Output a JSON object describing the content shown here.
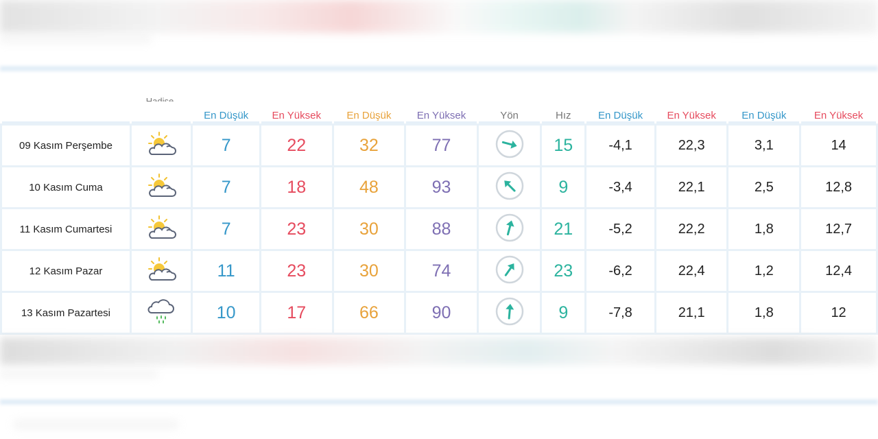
{
  "header": {
    "hadise": "Hadise",
    "columns": [
      "En Düşük",
      "En Yüksek",
      "En Düşük",
      "En Yüksek",
      "Yön",
      "Hız",
      "En Düşük",
      "En Yüksek",
      "En Düşük",
      "En Yüksek"
    ]
  },
  "rows": [
    {
      "day": "09 Kasım Perşembe",
      "icon": "partly-cloudy-sun-icon",
      "c1": "7",
      "c2": "22",
      "c3": "32",
      "c4": "77",
      "wind_dir": "arrow-right-icon",
      "wind_speed": "15",
      "c7": "-4,1",
      "c8": "22,3",
      "c9": "3,1",
      "c10": "14"
    },
    {
      "day": "10 Kasım Cuma",
      "icon": "partly-cloudy-sun-icon",
      "c1": "7",
      "c2": "18",
      "c3": "48",
      "c4": "93",
      "wind_dir": "arrow-down-left-icon",
      "wind_speed": "9",
      "c7": "-3,4",
      "c8": "22,1",
      "c9": "2,5",
      "c10": "12,8"
    },
    {
      "day": "11 Kasım Cumartesi",
      "icon": "partly-cloudy-sun-icon",
      "c1": "7",
      "c2": "23",
      "c3": "30",
      "c4": "88",
      "wind_dir": "arrow-up-slight-right-icon",
      "wind_speed": "21",
      "c7": "-5,2",
      "c8": "22,2",
      "c9": "1,8",
      "c10": "12,7"
    },
    {
      "day": "12 Kasım Pazar",
      "icon": "partly-cloudy-sun-icon",
      "c1": "11",
      "c2": "23",
      "c3": "30",
      "c4": "74",
      "wind_dir": "arrow-up-right-icon",
      "wind_speed": "23",
      "c7": "-6,2",
      "c8": "22,4",
      "c9": "1,2",
      "c10": "12,4"
    },
    {
      "day": "13 Kasım Pazartesi",
      "icon": "rain-cloud-icon",
      "c1": "10",
      "c2": "17",
      "c3": "66",
      "c4": "90",
      "wind_dir": "arrow-up-icon",
      "wind_speed": "9",
      "c7": "-7,8",
      "c8": "21,1",
      "c9": "1,8",
      "c10": "12"
    }
  ],
  "colors": {
    "blue": "#3597c9",
    "red": "#e64b5e",
    "orange": "#e8a23a",
    "purple": "#7e6fb3",
    "teal": "#2bb39e",
    "grid": "#e8f1f8"
  }
}
